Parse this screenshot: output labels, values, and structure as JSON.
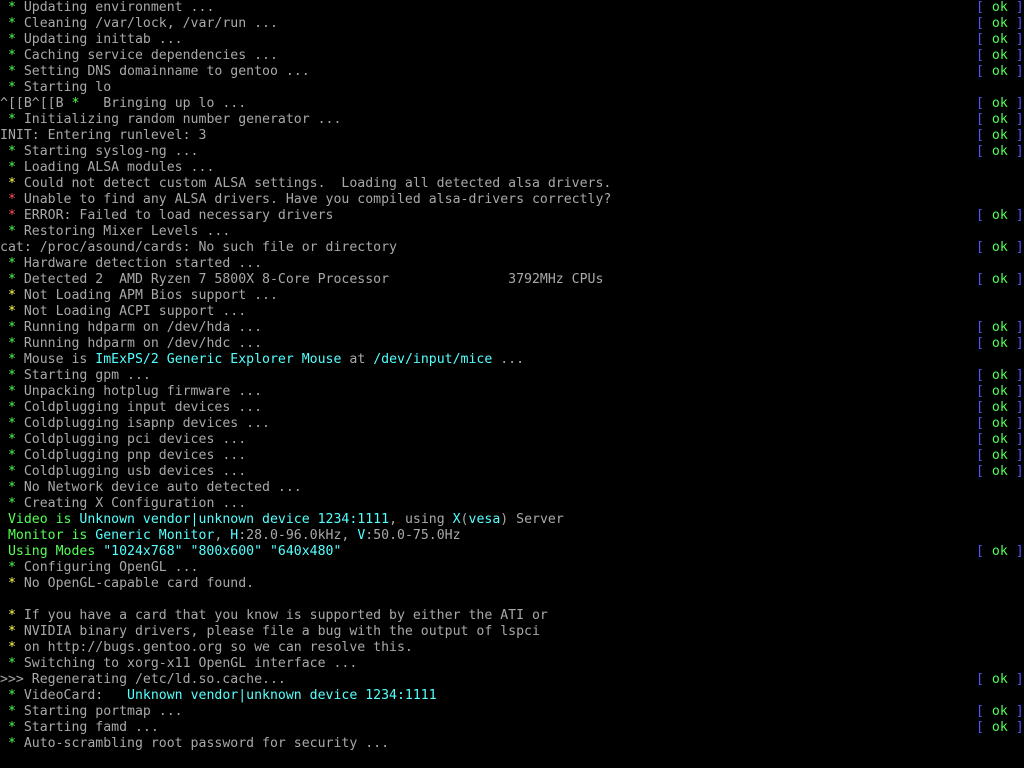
{
  "colors": {
    "background": "#000000",
    "text": "#a8a8a8",
    "green": "#54ff54",
    "yellow": "#ffff54",
    "red": "#ff5454",
    "cyan": "#54ffff",
    "blue": "#5454ff"
  },
  "status": {
    "open": "[ ",
    "ok": "ok",
    "close": " ]"
  },
  "lines": [
    {
      "m": "ok",
      "segs": [
        [
          "w",
          " Updating environment ..."
        ]
      ],
      "ok": true
    },
    {
      "m": "ok",
      "segs": [
        [
          "w",
          " Cleaning /var/lock, /var/run ..."
        ]
      ],
      "ok": true
    },
    {
      "m": "ok",
      "segs": [
        [
          "w",
          " Updating inittab ..."
        ]
      ],
      "ok": true
    },
    {
      "m": "ok",
      "segs": [
        [
          "w",
          " Caching service dependencies ..."
        ]
      ],
      "ok": true
    },
    {
      "m": "ok",
      "segs": [
        [
          "w",
          " Setting DNS domainname to gentoo ..."
        ]
      ],
      "ok": true
    },
    {
      "m": "ok",
      "segs": [
        [
          "w",
          " Starting lo"
        ]
      ],
      "ok": false
    },
    {
      "m": "",
      "segs": [
        [
          "w",
          "^[[B^[[B "
        ],
        [
          "g",
          "*"
        ],
        [
          "w",
          "   Bringing up lo ..."
        ]
      ],
      "ok": true
    },
    {
      "m": "ok",
      "segs": [
        [
          "w",
          " Initializing random number generator ..."
        ]
      ],
      "ok": true
    },
    {
      "m": "",
      "segs": [
        [
          "w",
          "INIT: Entering runlevel: 3"
        ]
      ],
      "ok": true
    },
    {
      "m": "ok",
      "segs": [
        [
          "w",
          " Starting syslog-ng ..."
        ]
      ],
      "ok": true
    },
    {
      "m": "ok",
      "segs": [
        [
          "w",
          " Loading ALSA modules ..."
        ]
      ],
      "ok": false
    },
    {
      "m": "warn",
      "segs": [
        [
          "w",
          " Could not detect custom ALSA settings.  Loading all detected alsa drivers."
        ]
      ],
      "ok": false
    },
    {
      "m": "bad",
      "segs": [
        [
          "w",
          " Unable to find any ALSA drivers. Have you compiled alsa-drivers correctly?"
        ]
      ],
      "ok": false
    },
    {
      "m": "bad",
      "segs": [
        [
          "w",
          " ERROR: Failed to load necessary drivers"
        ]
      ],
      "ok": true
    },
    {
      "m": "ok",
      "segs": [
        [
          "w",
          " Restoring Mixer Levels ..."
        ]
      ],
      "ok": false
    },
    {
      "m": "",
      "segs": [
        [
          "w",
          "cat: /proc/asound/cards: No such file or directory"
        ]
      ],
      "ok": true
    },
    {
      "m": "ok",
      "segs": [
        [
          "w",
          " Hardware detection started ..."
        ]
      ],
      "ok": false
    },
    {
      "m": "ok",
      "segs": [
        [
          "w",
          " Detected 2  AMD Ryzen 7 5800X 8-Core Processor               3792MHz CPUs"
        ]
      ],
      "ok": true
    },
    {
      "m": "warn",
      "segs": [
        [
          "w",
          " Not Loading APM Bios support ..."
        ]
      ],
      "ok": false
    },
    {
      "m": "warn",
      "segs": [
        [
          "w",
          " Not Loading ACPI support ..."
        ]
      ],
      "ok": false
    },
    {
      "m": "ok",
      "segs": [
        [
          "w",
          " Running hdparm on /dev/hda ..."
        ]
      ],
      "ok": true
    },
    {
      "m": "ok",
      "segs": [
        [
          "w",
          " Running hdparm on /dev/hdc ..."
        ]
      ],
      "ok": true
    },
    {
      "m": "ok",
      "segs": [
        [
          "w",
          " Mouse is "
        ],
        [
          "c",
          "ImExPS/2 Generic Explorer Mouse"
        ],
        [
          "w",
          " at "
        ],
        [
          "c",
          "/dev/input/mice"
        ],
        [
          "w",
          " ..."
        ]
      ],
      "ok": false
    },
    {
      "m": "ok",
      "segs": [
        [
          "w",
          " Starting gpm ..."
        ]
      ],
      "ok": true
    },
    {
      "m": "ok",
      "segs": [
        [
          "w",
          " Unpacking hotplug firmware ..."
        ]
      ],
      "ok": true
    },
    {
      "m": "ok",
      "segs": [
        [
          "w",
          " Coldplugging input devices ..."
        ]
      ],
      "ok": true
    },
    {
      "m": "ok",
      "segs": [
        [
          "w",
          " Coldplugging isapnp devices ..."
        ]
      ],
      "ok": true
    },
    {
      "m": "ok",
      "segs": [
        [
          "w",
          " Coldplugging pci devices ..."
        ]
      ],
      "ok": true
    },
    {
      "m": "ok",
      "segs": [
        [
          "w",
          " Coldplugging pnp devices ..."
        ]
      ],
      "ok": true
    },
    {
      "m": "ok",
      "segs": [
        [
          "w",
          " Coldplugging usb devices ..."
        ]
      ],
      "ok": true
    },
    {
      "m": "ok",
      "segs": [
        [
          "w",
          " No Network device auto detected ..."
        ]
      ],
      "ok": false
    },
    {
      "m": "ok",
      "segs": [
        [
          "w",
          " Creating X Configuration ..."
        ]
      ],
      "ok": false
    },
    {
      "m": "",
      "segs": [
        [
          "g",
          " Video is "
        ],
        [
          "c",
          "Unknown vendor|unknown device 1234:1111"
        ],
        [
          "w",
          ", using "
        ],
        [
          "c",
          "X"
        ],
        [
          "w",
          "("
        ],
        [
          "c",
          "vesa"
        ],
        [
          "w",
          ") Server"
        ]
      ],
      "ok": false
    },
    {
      "m": "",
      "segs": [
        [
          "g",
          " Monitor is "
        ],
        [
          "c",
          "Generic Monitor"
        ],
        [
          "w",
          ", "
        ],
        [
          "c",
          "H"
        ],
        [
          "w",
          ":28.0-96.0kHz, "
        ],
        [
          "c",
          "V"
        ],
        [
          "w",
          ":50.0-75.0Hz"
        ]
      ],
      "ok": false
    },
    {
      "m": "",
      "segs": [
        [
          "g",
          " Using Modes "
        ],
        [
          "c",
          "\"1024x768\" \"800x600\" \"640x480\""
        ]
      ],
      "ok": true
    },
    {
      "m": "ok",
      "segs": [
        [
          "w",
          " Configuring OpenGL ..."
        ]
      ],
      "ok": false
    },
    {
      "m": "warn",
      "segs": [
        [
          "w",
          " No OpenGL-capable card found."
        ]
      ],
      "ok": false
    },
    {
      "m": "",
      "segs": [
        [
          "w",
          ""
        ]
      ],
      "ok": false
    },
    {
      "m": "warn",
      "segs": [
        [
          "w",
          " If you have a card that you know is supported by either the ATI or"
        ]
      ],
      "ok": false
    },
    {
      "m": "warn",
      "segs": [
        [
          "w",
          " NVIDIA binary drivers, please file a bug with the output of lspci"
        ]
      ],
      "ok": false
    },
    {
      "m": "warn",
      "segs": [
        [
          "w",
          " on http://bugs.gentoo.org so we can resolve this."
        ]
      ],
      "ok": false
    },
    {
      "m": "ok",
      "segs": [
        [
          "w",
          " Switching to xorg-x11 OpenGL interface ..."
        ]
      ],
      "ok": false
    },
    {
      "m": "",
      "segs": [
        [
          "w",
          ">>> Regenerating /etc/ld.so.cache..."
        ]
      ],
      "ok": true
    },
    {
      "m": "ok",
      "segs": [
        [
          "w",
          " VideoCard:   "
        ],
        [
          "c",
          "Unknown vendor|unknown device 1234:1111"
        ]
      ],
      "ok": false
    },
    {
      "m": "ok",
      "segs": [
        [
          "w",
          " Starting portmap ..."
        ]
      ],
      "ok": true
    },
    {
      "m": "ok",
      "segs": [
        [
          "w",
          " Starting famd ..."
        ]
      ],
      "ok": true
    },
    {
      "m": "ok",
      "segs": [
        [
          "w",
          " Auto-scrambling root password for security ..."
        ]
      ],
      "ok": false
    }
  ]
}
